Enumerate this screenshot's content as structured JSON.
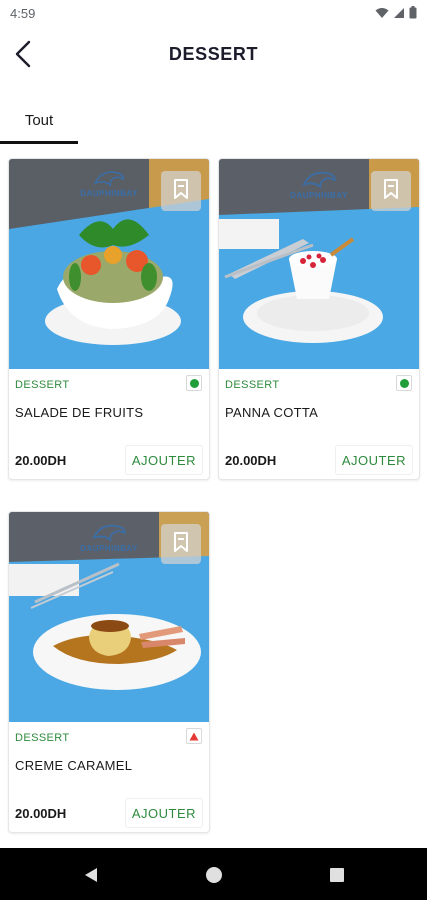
{
  "status_bar": {
    "time": "4:59",
    "icons": [
      "wifi-icon",
      "signal-icon",
      "battery-icon"
    ]
  },
  "header": {
    "title": "DESSERT",
    "back_icon": "chevron-left-icon"
  },
  "tabs": [
    {
      "label": "Tout",
      "selected": true
    }
  ],
  "products": [
    {
      "brand": "DAUPHINBAY",
      "category": "DESSERT",
      "name": "SALADE DE FRUITS",
      "price": "20.00DH",
      "add_label": "AJOUTER",
      "diet": "veg"
    },
    {
      "brand": "DAUPHINBAY",
      "category": "DESSERT",
      "name": "PANNA COTTA",
      "price": "20.00DH",
      "add_label": "AJOUTER",
      "diet": "veg"
    },
    {
      "brand": "DAUPHINBAY",
      "category": "DESSERT",
      "name": "CREME CARAMEL",
      "price": "20.00DH",
      "add_label": "AJOUTER",
      "diet": "non-veg"
    }
  ],
  "colors": {
    "accent_green": "#2e8b3d",
    "veg_dot": "#1f9e3a",
    "nonveg_triangle": "#e53935",
    "tab_indicator": "#111111"
  },
  "nav_bar": {
    "icons": [
      "back-triangle-icon",
      "home-circle-icon",
      "recents-square-icon"
    ]
  }
}
